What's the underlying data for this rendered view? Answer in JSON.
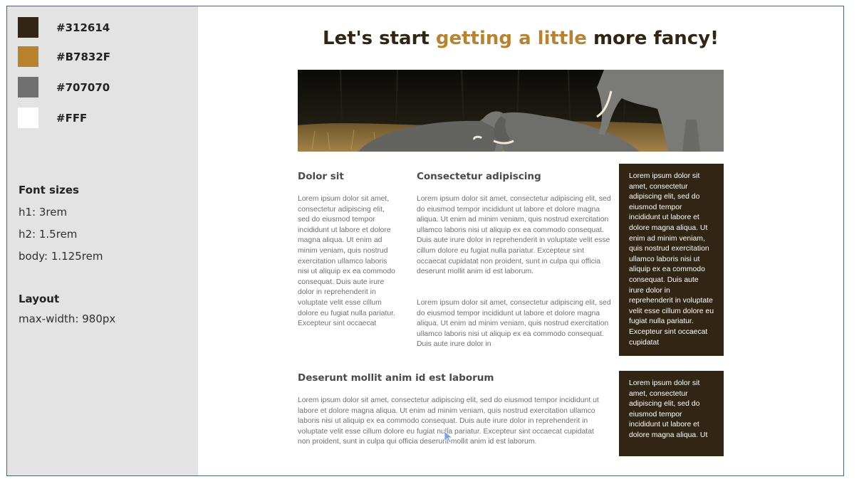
{
  "palette": [
    {
      "hex": "#312614",
      "label": "#312614"
    },
    {
      "hex": "#B7832F",
      "label": "#B7832F"
    },
    {
      "hex": "#707070",
      "label": "#707070"
    },
    {
      "hex": "#FFFFFF",
      "label": "#FFF"
    }
  ],
  "font_sizes": {
    "heading": "Font sizes",
    "h1": "h1: 3rem",
    "h2": "h2: 1.5rem",
    "body": "body: 1.125rem"
  },
  "layout": {
    "heading": "Layout",
    "max_width": "max-width: 980px"
  },
  "mockup": {
    "title_start": "Let's start ",
    "title_accent": "getting a little",
    "title_end": " more fancy!",
    "col1": {
      "heading": "Dolor sit",
      "text": "Lorem ipsum dolor sit amet, consectetur adipiscing elit, sed do eiusmod tempor incididunt ut labore et dolore magna aliqua. Ut enim ad minim veniam, quis nostrud exercitation ullamco laboris nisi ut aliquip ex ea commodo consequat. Duis aute irure dolor in reprehenderit in voluptate velit esse cillum dolore eu fugiat nulla pariatur. Excepteur sint occaecat"
    },
    "col2": {
      "heading": "Consectetur adipiscing",
      "para1": "Lorem ipsum dolor sit amet, consectetur adipiscing elit, sed do eiusmod tempor incididunt ut labore et dolore magna aliqua. Ut enim ad minim veniam, quis nostrud exercitation ullamco laboris nisi ut aliquip ex ea commodo consequat. Duis aute irure dolor in reprehenderit in voluptate velit esse cillum dolore eu fugiat nulla pariatur. Excepteur sint occaecat cupidatat non proident, sunt in culpa qui officia deserunt mollit anim id est laborum.",
      "para2": "Lorem ipsum dolor sit amet, consectetur adipiscing elit, sed do eiusmod tempor incididunt ut labore et dolore magna aliqua. Ut enim ad minim veniam, quis nostrud exercitation ullamco laboris nisi ut aliquip ex ea commodo consequat. Duis aute irure dolor in"
    },
    "aside1": "Lorem ipsum dolor sit amet, consectetur adipiscing elit, sed do eiusmod tempor incididunt ut labore et dolore magna aliqua. Ut enim ad minim veniam, quis nostrud exercitation ullamco laboris nisi ut aliquip ex ea commodo consequat. Duis aute irure dolor in reprehenderit in voluptate velit esse cillum dolore eu fugiat nulla pariatur. Excepteur sint occaecat cupidatat",
    "section2": {
      "heading": "Deserunt mollit anim id est laborum",
      "text": "Lorem ipsum dolor sit amet, consectetur adipiscing elit, sed do eiusmod tempor incididunt ut labore et dolore magna aliqua. Ut enim ad minim veniam, quis nostrud exercitation ullamco laboris nisi ut aliquip ex ea commodo consequat. Duis aute irure dolor in reprehenderit in voluptate velit esse cillum dolore eu fugiat nulla pariatur. Excepteur sint occaecat cupidatat non proident, sunt in culpa qui officia deserunt mollit anim id est laborum."
    },
    "aside2": "Lorem ipsum dolor sit amet, consectetur adipiscing elit, sed do eiusmod tempor incididunt ut labore et dolore magna aliqua. Ut",
    "hero_image": "elephants-photo",
    "cursor_icon": "mouse-pointer-icon"
  }
}
